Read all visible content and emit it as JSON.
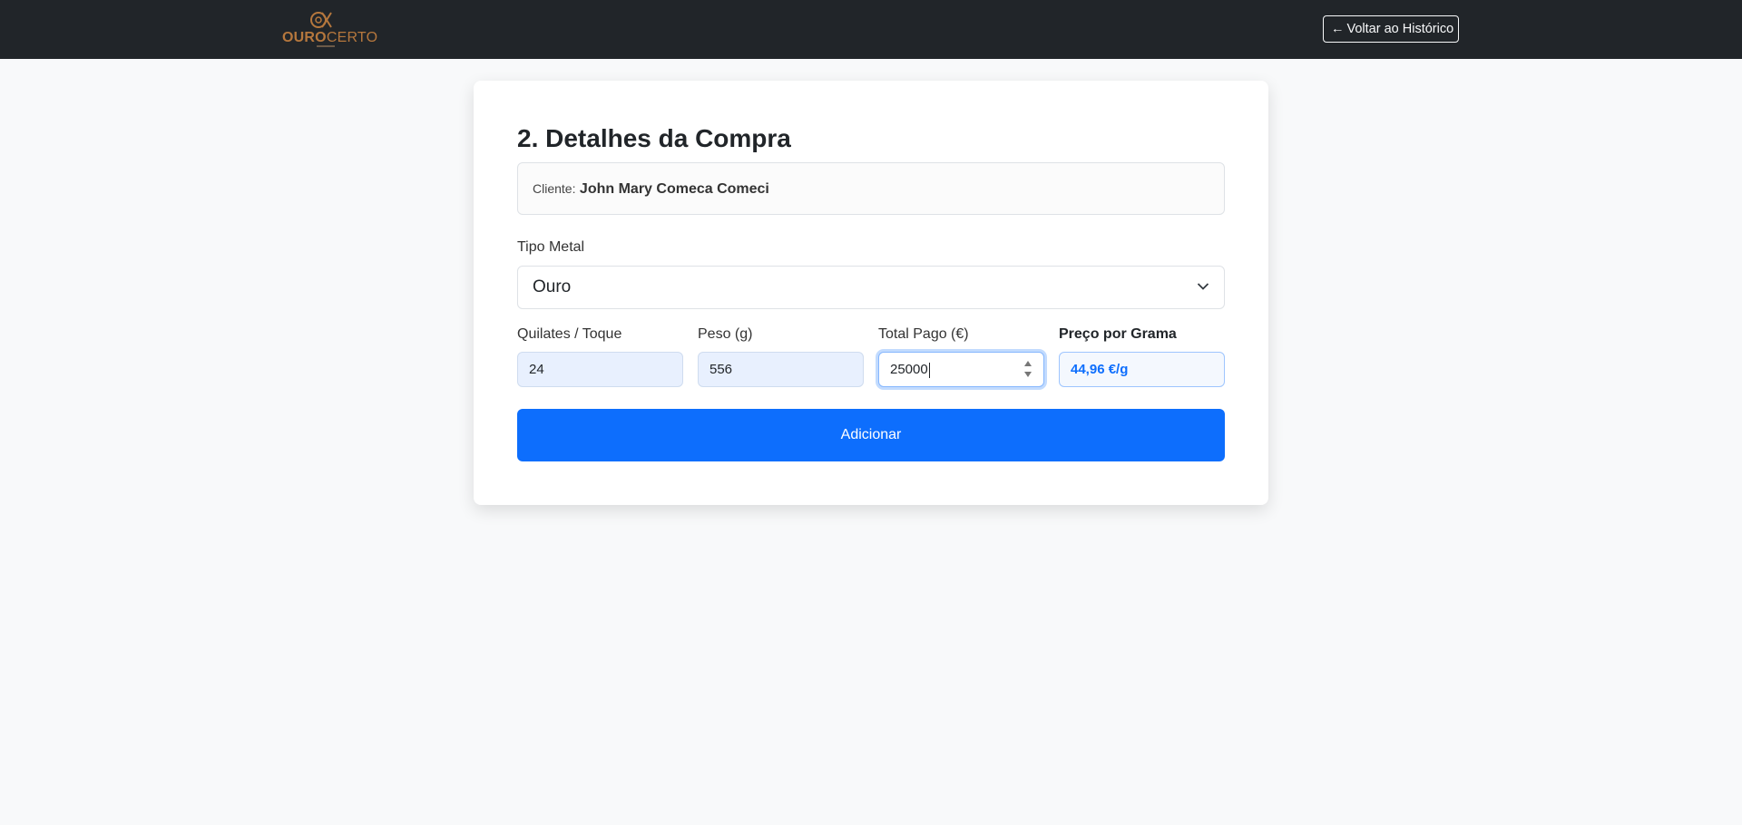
{
  "navbar": {
    "logo": {
      "brand_bold": "OURO",
      "brand_light": "CERTO"
    },
    "back_button": {
      "arrow": "←",
      "label": "Voltar ao Histórico"
    }
  },
  "form": {
    "title": "2. Detalhes da Compra",
    "client": {
      "label": "Cliente:",
      "name": "John Mary Comeca Comeci"
    },
    "metal_type": {
      "label": "Tipo Metal",
      "selected": "Ouro"
    },
    "carats": {
      "label": "Quilates / Toque",
      "value": "24"
    },
    "weight": {
      "label": "Peso (g)",
      "value": "556"
    },
    "total_paid": {
      "label": "Total Pago (€)",
      "value": "25000"
    },
    "price_per_gram": {
      "label": "Preço por Grama",
      "value": "44,96 €/g"
    },
    "add_button": {
      "label": "Adicionar"
    }
  },
  "colors": {
    "navbar_bg": "#212529",
    "brand": "#b5773d",
    "primary": "#0d6efd",
    "page_bg": "#f8f9fa"
  },
  "icons": {
    "logo": "ouro-certo-logo-icon",
    "back": "arrow-left-icon",
    "select": "chevron-down-icon",
    "spinner": "number-spinner-icon"
  }
}
